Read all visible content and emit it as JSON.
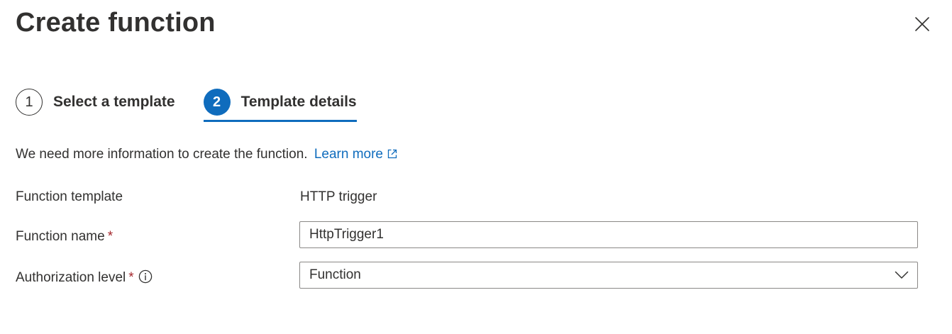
{
  "dialog": {
    "title": "Create function",
    "close_icon": "close-icon"
  },
  "steps": [
    {
      "number": "1",
      "label": "Select a template",
      "state": "inactive"
    },
    {
      "number": "2",
      "label": "Template details",
      "state": "active"
    }
  ],
  "info": {
    "text": "We need more information to create the function.",
    "link_label": "Learn more",
    "link_icon": "external-link-icon"
  },
  "form": {
    "function_template": {
      "label": "Function template",
      "value": "HTTP trigger"
    },
    "function_name": {
      "label": "Function name",
      "required_marker": "*",
      "value": "HttpTrigger1"
    },
    "authorization_level": {
      "label": "Authorization level",
      "required_marker": "*",
      "info_icon": "info-icon",
      "value": "Function"
    }
  },
  "colors": {
    "accent": "#0f6cbd",
    "text": "#323130",
    "required": "#a4262c",
    "border": "#8a8886"
  }
}
